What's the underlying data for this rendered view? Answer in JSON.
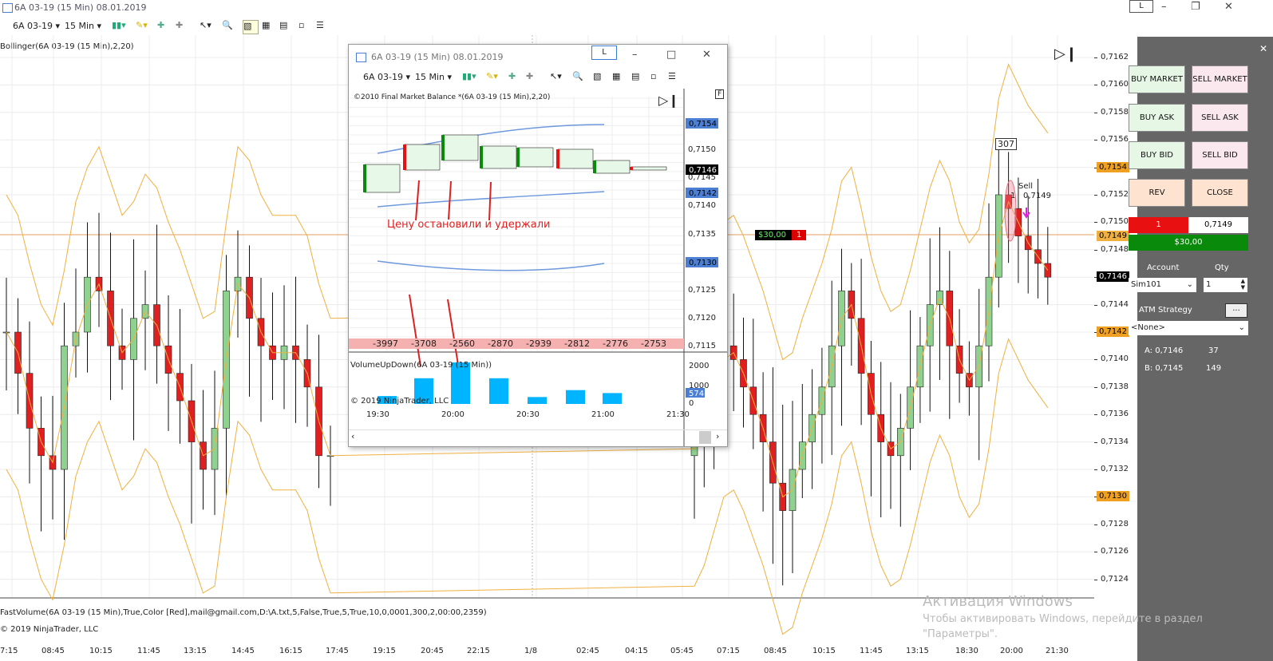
{
  "window": {
    "title": "6A 03-19 (15 Min)  08.01.2019",
    "l_label": "L"
  },
  "toolbar": {
    "instrument": "6A 03-19",
    "interval": "15 Min"
  },
  "indicator_top": "Bollinger(6A 03-19 (15 Min),2,20)",
  "indicator_bottom": "FastVolume(6A 03-19 (15 Min),True,Color [Red],mail@gmail.com,D:\\A.txt,5,False,True,5,True,10,0,0001,300,2,00:00,2359)",
  "copyright": "© 2019 NinjaTrader, LLC",
  "price_axis": [
    "0,7162",
    "0,7160",
    "0,7158",
    "0,7156",
    "0,7154",
    "0,7152",
    "0,7150",
    "0,7148",
    "0,7146",
    "0,7144",
    "0,7142",
    "0,7140",
    "0,7138",
    "0,7136",
    "0,7134",
    "0,7132",
    "0,7130",
    "0,7128",
    "0,7126",
    "0,7124"
  ],
  "price_badges": {
    "upper": "0,7154",
    "position": "0,7149",
    "last": "0,7146",
    "mid": "0,7142",
    "lower": "0,7130"
  },
  "time_axis": [
    "7:15",
    "08:45",
    "10:15",
    "11:45",
    "13:15",
    "14:45",
    "16:15",
    "17:45",
    "19:15",
    "20:45",
    "22:15",
    "1/8",
    "02:45",
    "04:15",
    "05:45",
    "07:15",
    "08:45",
    "10:15",
    "11:45",
    "13:15",
    "18:30",
    "20:00",
    "21:30"
  ],
  "order_marker": {
    "pnl": "$30,00",
    "qty": "1"
  },
  "trade_label": {
    "count": "307",
    "side": "Sell",
    "qty": "1",
    "price": "0,7149"
  },
  "side_panel": {
    "buy_market": "BUY MARKET",
    "sell_market": "SELL MARKET",
    "buy_ask": "BUY ASK",
    "sell_ask": "SELL ASK",
    "buy_bid": "BUY BID",
    "sell_bid": "SELL BID",
    "rev": "REV",
    "close": "CLOSE",
    "position_qty": "1",
    "position_price": "0,7149",
    "pnl": "$30,00",
    "account_label": "Account",
    "qty_label": "Qty",
    "account": "Sim101",
    "qty": "1",
    "atm_label": "ATM Strategy",
    "atm_btn": "...",
    "atm_value": "<None>",
    "ask": "A: 0,7146",
    "ask_size": "37",
    "bid": "B: 0,7145",
    "bid_size": "149"
  },
  "popup": {
    "title": "6A 03-19 (15 Min)  08.01.2019",
    "l_label": "L",
    "instrument": "6A 03-19",
    "interval": "15 Min",
    "indicator": "©2010 Final Market Balance *(6A 03-19 (15 Min),2,20)",
    "f_label": "F",
    "annotation": "Цену остановили и удержали",
    "deltas": [
      "-3997",
      "-3708",
      "-2560",
      "-2870",
      "-2939",
      "-2812",
      "-2776",
      "-2753"
    ],
    "volume_title": "VolumeUpDown(6A 03-19 (15 Min))",
    "copyright": "© 2019 NinjaTrader, LLC",
    "price_axis": [
      "0,7150",
      "0,7145",
      "0,7140",
      "0,7135",
      "0,7130",
      "0,7125",
      "0,7120",
      "0,7115"
    ],
    "badges": {
      "top": "0,7154",
      "last": "0,7146",
      "mid": "0,7142",
      "low": "0,7130"
    },
    "vol_axis": [
      "2000",
      "1000",
      "0"
    ],
    "vol_badge": "574",
    "time_axis": [
      "19:30",
      "20:00",
      "20:30",
      "21:00",
      "21:30"
    ],
    "volumes": [
      400,
      1300,
      2100,
      1300,
      350,
      700,
      550
    ]
  },
  "watermark": {
    "line1": "Активация Windows",
    "line2": "Чтобы активировать Windows, перейдите в раздел",
    "line3": "\"Параметры\"."
  },
  "colors": {
    "up": "#8fd18f",
    "down": "#e02020",
    "band": "#f0b040",
    "side_bg": "#666666",
    "popup_blue": "#4a7fd4"
  }
}
